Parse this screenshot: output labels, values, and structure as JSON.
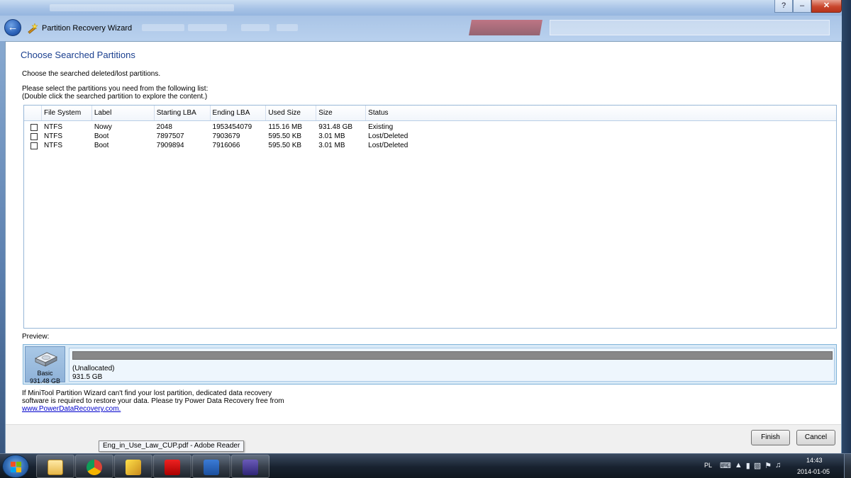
{
  "window": {
    "title": "Partition Recovery Wizard",
    "buttons": {
      "help": "?",
      "minimize": "–",
      "close": "✕"
    }
  },
  "page": {
    "heading": "Choose Searched Partitions",
    "description": "Choose the searched deleted/lost partitions.",
    "instruction_line1": "Please select the partitions you need from the following list:",
    "instruction_line2": "(Double click the searched partition to explore the content.)"
  },
  "table": {
    "columns": [
      "File System",
      "Label",
      "Starting LBA",
      "Ending LBA",
      "Used Size",
      "Size",
      "Status"
    ],
    "rows": [
      {
        "file_system": "NTFS",
        "label": "Nowy",
        "starting_lba": "2048",
        "ending_lba": "1953454079",
        "used_size": "115.16 MB",
        "size": "931.48 GB",
        "status": "Existing",
        "checked": false
      },
      {
        "file_system": "NTFS",
        "label": "Boot",
        "starting_lba": "7897507",
        "ending_lba": "7903679",
        "used_size": "595.50 KB",
        "size": "3.01 MB",
        "status": "Lost/Deleted",
        "checked": false
      },
      {
        "file_system": "NTFS",
        "label": "Boot",
        "starting_lba": "7909894",
        "ending_lba": "7916066",
        "used_size": "595.50 KB",
        "size": "3.01 MB",
        "status": "Lost/Deleted",
        "checked": false
      }
    ]
  },
  "preview": {
    "label": "Preview:",
    "disk_type": "Basic",
    "disk_size": "931.48 GB",
    "partition_name": "(Unallocated)",
    "partition_size": "931.5 GB"
  },
  "info": {
    "line1": "If MiniTool Partition Wizard can't find your lost partition, dedicated data recovery",
    "line2": "software is required to restore your data. Please try Power Data Recovery free from",
    "link": "www.PowerDataRecovery.com."
  },
  "buttons": {
    "finish": "Finish",
    "cancel": "Cancel"
  },
  "tooltip": "Eng_in_Use_Law_CUP.pdf - Adobe Reader",
  "taskbar": {
    "apps": [
      "explorer",
      "chrome",
      "partition-wizard",
      "adobe-reader",
      "word",
      "pirate-app"
    ],
    "language": "PL",
    "time": "14:43",
    "date": "2014-01-05"
  }
}
